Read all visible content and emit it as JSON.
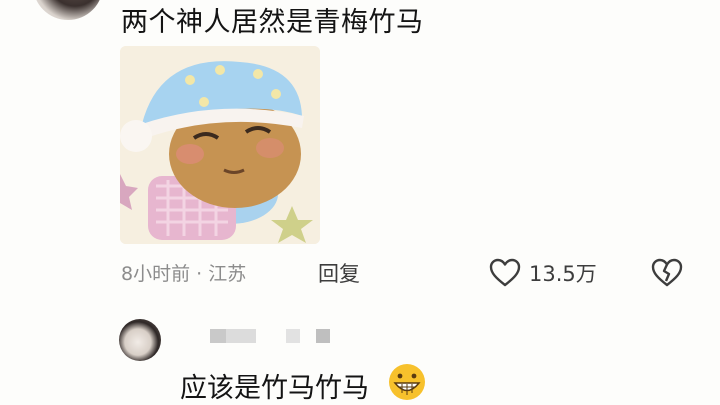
{
  "comment": {
    "text": "两个神人居然是青梅竹马",
    "meta": "8小时前 · 江苏",
    "reply_label": "回复",
    "like_count": "13.5万"
  },
  "reply": {
    "text": "应该是竹马竹马"
  },
  "icons": {
    "like": "heart-outline-icon",
    "dislike": "broken-heart-icon",
    "emoji": "grinning-emoji"
  },
  "colors": {
    "text": "#141414",
    "meta": "#8c8c8c",
    "icon": "#3d3d3d",
    "background": "#fdfdfb"
  }
}
